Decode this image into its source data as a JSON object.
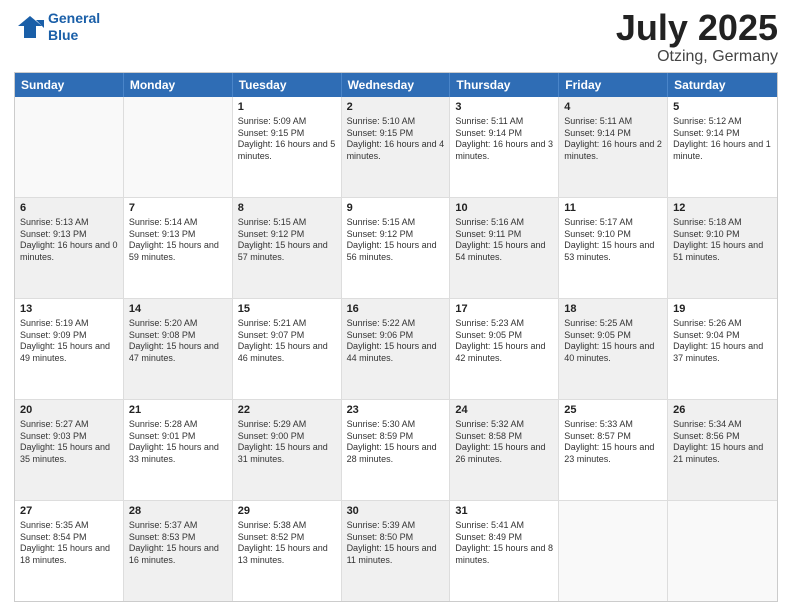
{
  "header": {
    "logo_line1": "General",
    "logo_line2": "Blue",
    "title": "July 2025",
    "location": "Otzing, Germany"
  },
  "weekdays": [
    "Sunday",
    "Monday",
    "Tuesday",
    "Wednesday",
    "Thursday",
    "Friday",
    "Saturday"
  ],
  "weeks": [
    [
      {
        "day": "",
        "sunrise": "",
        "sunset": "",
        "daylight": "",
        "shaded": false,
        "empty": true
      },
      {
        "day": "",
        "sunrise": "",
        "sunset": "",
        "daylight": "",
        "shaded": false,
        "empty": true
      },
      {
        "day": "1",
        "sunrise": "Sunrise: 5:09 AM",
        "sunset": "Sunset: 9:15 PM",
        "daylight": "Daylight: 16 hours and 5 minutes.",
        "shaded": false,
        "empty": false
      },
      {
        "day": "2",
        "sunrise": "Sunrise: 5:10 AM",
        "sunset": "Sunset: 9:15 PM",
        "daylight": "Daylight: 16 hours and 4 minutes.",
        "shaded": true,
        "empty": false
      },
      {
        "day": "3",
        "sunrise": "Sunrise: 5:11 AM",
        "sunset": "Sunset: 9:14 PM",
        "daylight": "Daylight: 16 hours and 3 minutes.",
        "shaded": false,
        "empty": false
      },
      {
        "day": "4",
        "sunrise": "Sunrise: 5:11 AM",
        "sunset": "Sunset: 9:14 PM",
        "daylight": "Daylight: 16 hours and 2 minutes.",
        "shaded": true,
        "empty": false
      },
      {
        "day": "5",
        "sunrise": "Sunrise: 5:12 AM",
        "sunset": "Sunset: 9:14 PM",
        "daylight": "Daylight: 16 hours and 1 minute.",
        "shaded": false,
        "empty": false
      }
    ],
    [
      {
        "day": "6",
        "sunrise": "Sunrise: 5:13 AM",
        "sunset": "Sunset: 9:13 PM",
        "daylight": "Daylight: 16 hours and 0 minutes.",
        "shaded": true,
        "empty": false
      },
      {
        "day": "7",
        "sunrise": "Sunrise: 5:14 AM",
        "sunset": "Sunset: 9:13 PM",
        "daylight": "Daylight: 15 hours and 59 minutes.",
        "shaded": false,
        "empty": false
      },
      {
        "day": "8",
        "sunrise": "Sunrise: 5:15 AM",
        "sunset": "Sunset: 9:12 PM",
        "daylight": "Daylight: 15 hours and 57 minutes.",
        "shaded": true,
        "empty": false
      },
      {
        "day": "9",
        "sunrise": "Sunrise: 5:15 AM",
        "sunset": "Sunset: 9:12 PM",
        "daylight": "Daylight: 15 hours and 56 minutes.",
        "shaded": false,
        "empty": false
      },
      {
        "day": "10",
        "sunrise": "Sunrise: 5:16 AM",
        "sunset": "Sunset: 9:11 PM",
        "daylight": "Daylight: 15 hours and 54 minutes.",
        "shaded": true,
        "empty": false
      },
      {
        "day": "11",
        "sunrise": "Sunrise: 5:17 AM",
        "sunset": "Sunset: 9:10 PM",
        "daylight": "Daylight: 15 hours and 53 minutes.",
        "shaded": false,
        "empty": false
      },
      {
        "day": "12",
        "sunrise": "Sunrise: 5:18 AM",
        "sunset": "Sunset: 9:10 PM",
        "daylight": "Daylight: 15 hours and 51 minutes.",
        "shaded": true,
        "empty": false
      }
    ],
    [
      {
        "day": "13",
        "sunrise": "Sunrise: 5:19 AM",
        "sunset": "Sunset: 9:09 PM",
        "daylight": "Daylight: 15 hours and 49 minutes.",
        "shaded": false,
        "empty": false
      },
      {
        "day": "14",
        "sunrise": "Sunrise: 5:20 AM",
        "sunset": "Sunset: 9:08 PM",
        "daylight": "Daylight: 15 hours and 47 minutes.",
        "shaded": true,
        "empty": false
      },
      {
        "day": "15",
        "sunrise": "Sunrise: 5:21 AM",
        "sunset": "Sunset: 9:07 PM",
        "daylight": "Daylight: 15 hours and 46 minutes.",
        "shaded": false,
        "empty": false
      },
      {
        "day": "16",
        "sunrise": "Sunrise: 5:22 AM",
        "sunset": "Sunset: 9:06 PM",
        "daylight": "Daylight: 15 hours and 44 minutes.",
        "shaded": true,
        "empty": false
      },
      {
        "day": "17",
        "sunrise": "Sunrise: 5:23 AM",
        "sunset": "Sunset: 9:05 PM",
        "daylight": "Daylight: 15 hours and 42 minutes.",
        "shaded": false,
        "empty": false
      },
      {
        "day": "18",
        "sunrise": "Sunrise: 5:25 AM",
        "sunset": "Sunset: 9:05 PM",
        "daylight": "Daylight: 15 hours and 40 minutes.",
        "shaded": true,
        "empty": false
      },
      {
        "day": "19",
        "sunrise": "Sunrise: 5:26 AM",
        "sunset": "Sunset: 9:04 PM",
        "daylight": "Daylight: 15 hours and 37 minutes.",
        "shaded": false,
        "empty": false
      }
    ],
    [
      {
        "day": "20",
        "sunrise": "Sunrise: 5:27 AM",
        "sunset": "Sunset: 9:03 PM",
        "daylight": "Daylight: 15 hours and 35 minutes.",
        "shaded": true,
        "empty": false
      },
      {
        "day": "21",
        "sunrise": "Sunrise: 5:28 AM",
        "sunset": "Sunset: 9:01 PM",
        "daylight": "Daylight: 15 hours and 33 minutes.",
        "shaded": false,
        "empty": false
      },
      {
        "day": "22",
        "sunrise": "Sunrise: 5:29 AM",
        "sunset": "Sunset: 9:00 PM",
        "daylight": "Daylight: 15 hours and 31 minutes.",
        "shaded": true,
        "empty": false
      },
      {
        "day": "23",
        "sunrise": "Sunrise: 5:30 AM",
        "sunset": "Sunset: 8:59 PM",
        "daylight": "Daylight: 15 hours and 28 minutes.",
        "shaded": false,
        "empty": false
      },
      {
        "day": "24",
        "sunrise": "Sunrise: 5:32 AM",
        "sunset": "Sunset: 8:58 PM",
        "daylight": "Daylight: 15 hours and 26 minutes.",
        "shaded": true,
        "empty": false
      },
      {
        "day": "25",
        "sunrise": "Sunrise: 5:33 AM",
        "sunset": "Sunset: 8:57 PM",
        "daylight": "Daylight: 15 hours and 23 minutes.",
        "shaded": false,
        "empty": false
      },
      {
        "day": "26",
        "sunrise": "Sunrise: 5:34 AM",
        "sunset": "Sunset: 8:56 PM",
        "daylight": "Daylight: 15 hours and 21 minutes.",
        "shaded": true,
        "empty": false
      }
    ],
    [
      {
        "day": "27",
        "sunrise": "Sunrise: 5:35 AM",
        "sunset": "Sunset: 8:54 PM",
        "daylight": "Daylight: 15 hours and 18 minutes.",
        "shaded": false,
        "empty": false
      },
      {
        "day": "28",
        "sunrise": "Sunrise: 5:37 AM",
        "sunset": "Sunset: 8:53 PM",
        "daylight": "Daylight: 15 hours and 16 minutes.",
        "shaded": true,
        "empty": false
      },
      {
        "day": "29",
        "sunrise": "Sunrise: 5:38 AM",
        "sunset": "Sunset: 8:52 PM",
        "daylight": "Daylight: 15 hours and 13 minutes.",
        "shaded": false,
        "empty": false
      },
      {
        "day": "30",
        "sunrise": "Sunrise: 5:39 AM",
        "sunset": "Sunset: 8:50 PM",
        "daylight": "Daylight: 15 hours and 11 minutes.",
        "shaded": true,
        "empty": false
      },
      {
        "day": "31",
        "sunrise": "Sunrise: 5:41 AM",
        "sunset": "Sunset: 8:49 PM",
        "daylight": "Daylight: 15 hours and 8 minutes.",
        "shaded": false,
        "empty": false
      },
      {
        "day": "",
        "sunrise": "",
        "sunset": "",
        "daylight": "",
        "shaded": true,
        "empty": true
      },
      {
        "day": "",
        "sunrise": "",
        "sunset": "",
        "daylight": "",
        "shaded": false,
        "empty": true
      }
    ]
  ]
}
